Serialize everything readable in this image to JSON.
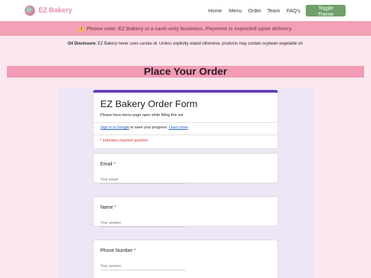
{
  "nav": {
    "brand": "EZ Bakery",
    "links": [
      "Home",
      "Menu",
      "Order",
      "Team",
      "FAQ's"
    ],
    "theme_button": "Toggle Theme"
  },
  "notice": {
    "icon": "warning-icon",
    "text": "Please note: EZ Bakery is a cash-only business. Payment is expected upon delivery."
  },
  "oil": {
    "label": "Oil Disclosure:",
    "text": " EZ Bakery never uses canola oil. Unless explicitly stated otherwise, products may contain soybean vegetable oil."
  },
  "page_heading": "Place Your Order",
  "form": {
    "title": "EZ Bakery Order Form",
    "description": "Please have menu page open while filling this out",
    "signin_link": "Sign in to Google",
    "signin_text": " to save your progress. ",
    "learn_more": "Learn more",
    "required_note": "* Indicates required question",
    "questions": [
      {
        "label": "Email",
        "star": " *",
        "placeholder": "Your email"
      },
      {
        "label": "Name",
        "star": " *",
        "placeholder": "Your answer"
      },
      {
        "label": "Phone Number",
        "star": " *",
        "placeholder": "Your answer"
      }
    ]
  },
  "colors": {
    "accent": "#673ab7",
    "brand": "#e88aa6",
    "notice_bg": "#f4a0b6",
    "button": "#6fa06a"
  }
}
